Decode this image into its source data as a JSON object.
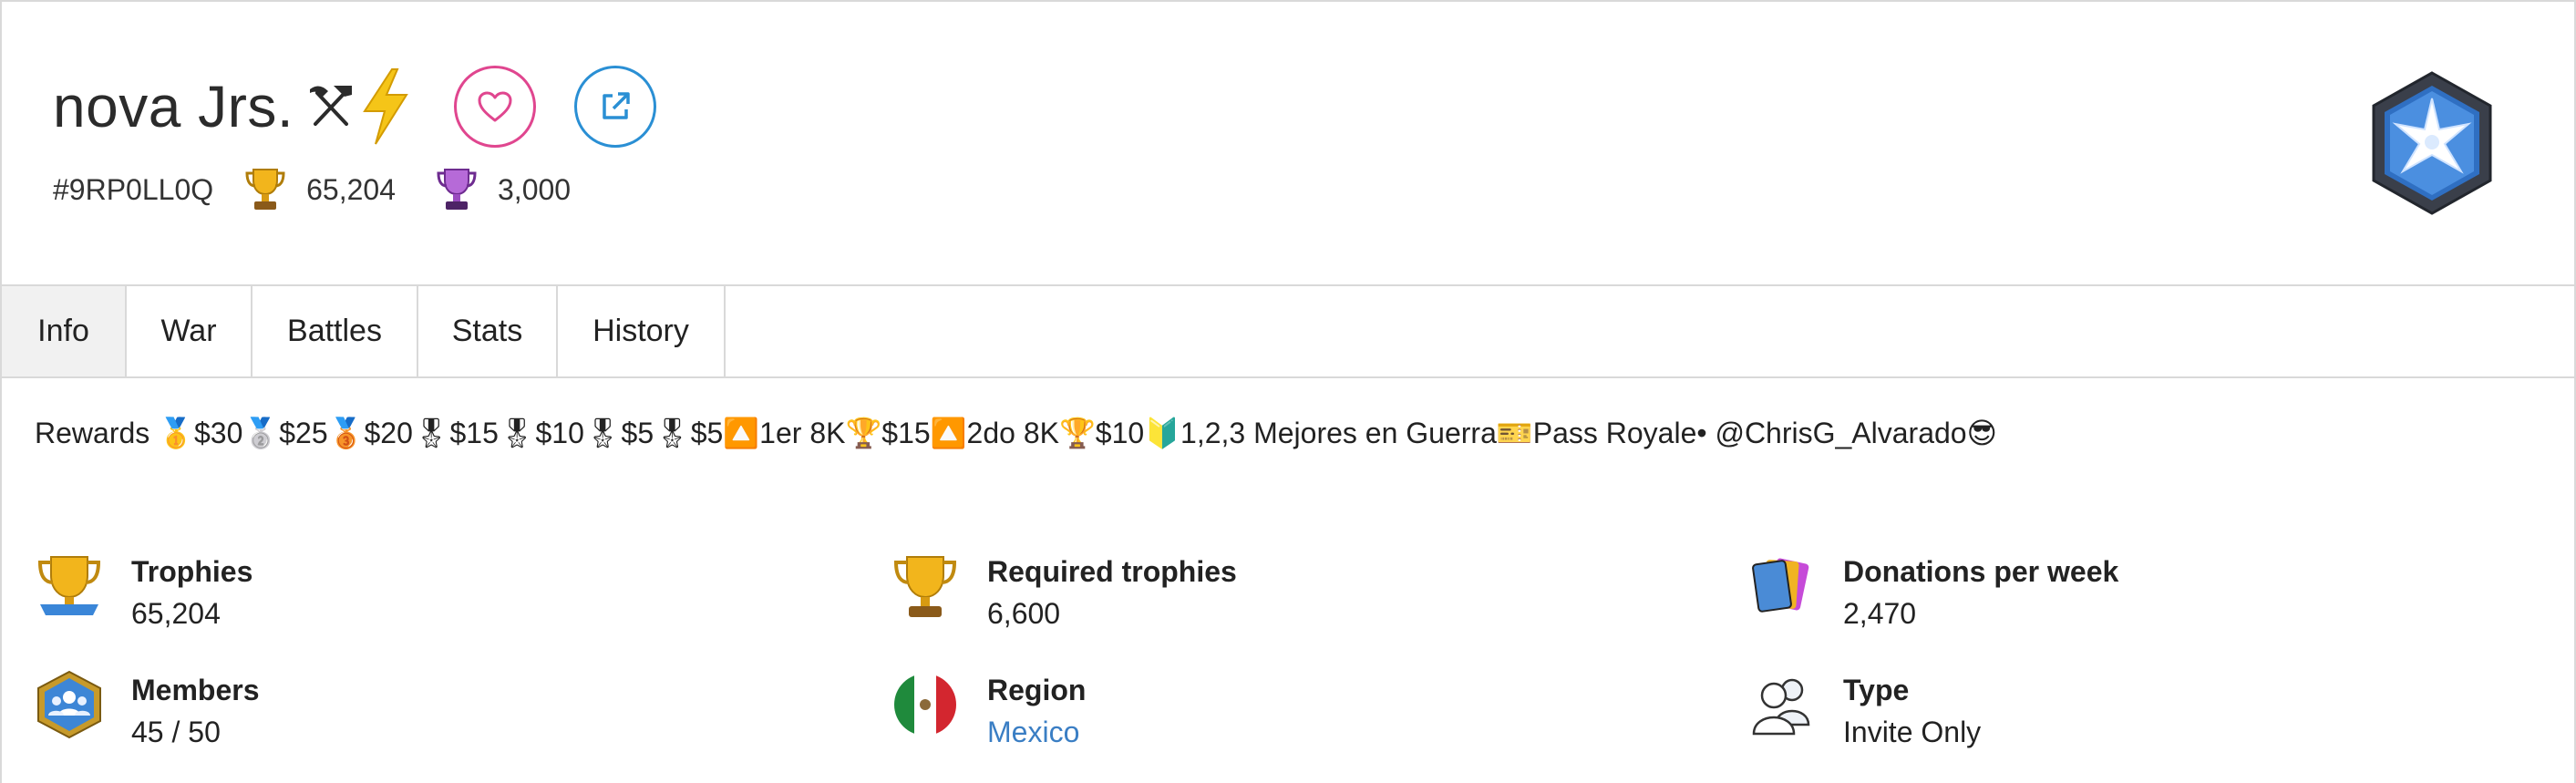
{
  "clan": {
    "name": "nova Jrs.",
    "name_symbols": "⚒⚡",
    "tag": "#9RP0LL0Q",
    "trophies": "65,204",
    "war_trophies": "3,000"
  },
  "icons": {
    "favorite": "heart-icon",
    "external": "external-link-icon",
    "clan_badge": "clan-badge-icon",
    "trophy": "trophy-icon",
    "war_trophy": "war-trophy-icon"
  },
  "colors": {
    "favorite_accent": "#e0468f",
    "external_accent": "#2a8fd4",
    "link": "#3a7ec4",
    "active_tab_bg": "#f1f1f1"
  },
  "tabs": [
    {
      "label": "Info",
      "active": true
    },
    {
      "label": "War",
      "active": false
    },
    {
      "label": "Battles",
      "active": false
    },
    {
      "label": "Stats",
      "active": false
    },
    {
      "label": "History",
      "active": false
    }
  ],
  "description": {
    "prefix": "Rewards",
    "parts": [
      "🥇",
      "$30",
      "🥈",
      "$25",
      "🥉",
      "$20",
      "🎖",
      "$15",
      "🎖",
      "$10",
      "🎖",
      "$5",
      "🎖",
      "$5",
      "🔼",
      "1er 8K ",
      "🏆",
      "$15",
      "🔼",
      "2do 8K",
      "🏆",
      "$10",
      "🔰",
      "1,2,3 Mejores en Guerra ",
      "🎫",
      "Pass Royale• @ChrisG_Alvarado",
      "😎"
    ]
  },
  "stats": {
    "trophies": {
      "label": "Trophies",
      "value": "65,204"
    },
    "required_trophies": {
      "label": "Required trophies",
      "value": "6,600"
    },
    "donations": {
      "label": "Donations per week",
      "value": "2,470"
    },
    "members": {
      "label": "Members",
      "value": "45 / 50"
    },
    "region": {
      "label": "Region",
      "value": "Mexico"
    },
    "type": {
      "label": "Type",
      "value": "Invite Only"
    }
  }
}
